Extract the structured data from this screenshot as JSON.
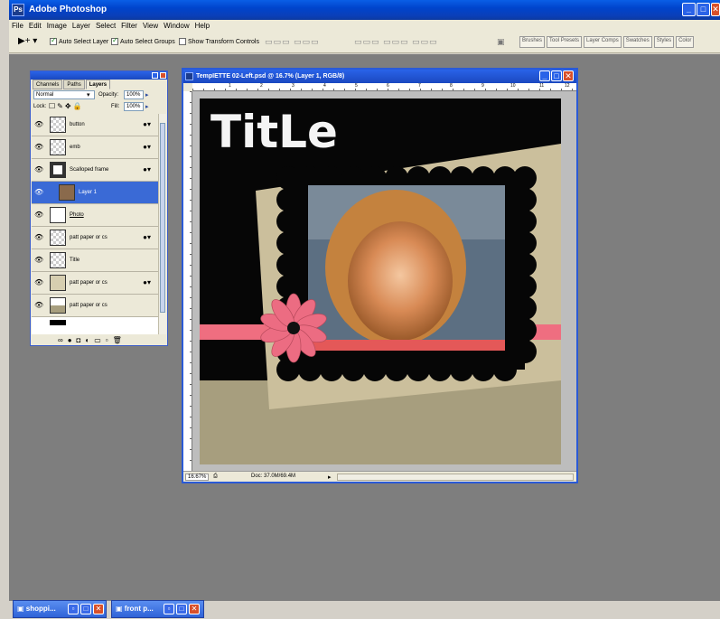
{
  "app": {
    "title": "Adobe Photoshop",
    "icon": "photoshop-icon",
    "logo_letters": "Ps"
  },
  "window_controls": {
    "minimize": "_",
    "maximize": "□",
    "close": "✕"
  },
  "menu": [
    "File",
    "Edit",
    "Image",
    "Layer",
    "Select",
    "Filter",
    "View",
    "Window",
    "Help"
  ],
  "options_bar": {
    "tool_glyph": "▶+ ▾",
    "auto_select_layer": {
      "label": "Auto Select Layer",
      "checked": true
    },
    "auto_select_groups": {
      "label": "Auto Select Groups",
      "checked": true
    },
    "show_transform_controls": {
      "label": "Show Transform Controls",
      "checked": false
    },
    "align_group_1": "▭▭▭ ▭▭▭",
    "align_group_2": "▭▭▭ ▭▭▭ ▭▭▭"
  },
  "palette_well": {
    "tabs": [
      "Brushes",
      "Tool Presets",
      "Layer Comps",
      "Swatches",
      "Styles",
      "Color"
    ]
  },
  "layers_palette": {
    "tabs": [
      "Channels",
      "Paths",
      "Layers"
    ],
    "active_tab": "Layers",
    "blend_mode": "Normal",
    "opacity_label": "Opacity:",
    "opacity_value": "100%",
    "lock_label": "Lock:",
    "fill_label": "Fill:",
    "fill_value": "100%",
    "layers": [
      {
        "name": "button",
        "fx": true,
        "selected": false
      },
      {
        "name": "emb",
        "fx": true,
        "selected": false
      },
      {
        "name": "Scalloped frame",
        "fx": true,
        "selected": false
      },
      {
        "name": "Layer 1",
        "fx": false,
        "selected": true
      },
      {
        "name": "Photo",
        "fx": false,
        "selected": false
      },
      {
        "name": "patt paper or cs",
        "fx": true,
        "selected": false
      },
      {
        "name": "Title",
        "fx": false,
        "selected": false
      },
      {
        "name": "patt paper or cs",
        "fx": true,
        "selected": false
      },
      {
        "name": "patt paper or cs",
        "fx": false,
        "selected": false
      }
    ]
  },
  "document": {
    "title": "TempIETTE 02-Left.psd @ 16.7% (Layer 1, RGB/8)",
    "zoom": "16.67%",
    "doc_size": "Doc: 37.0M/69.4M",
    "canvas_title_text": "TitLe",
    "ruler_numbers": [
      "1",
      "2",
      "3",
      "4",
      "5",
      "6",
      "7",
      "8",
      "9",
      "10",
      "11",
      "12"
    ],
    "colors": {
      "black": "#060606",
      "tan_paper": "#cbbf9c",
      "khaki_bottom": "#a79e7e",
      "ribbon_pink": "#ef6e80",
      "flower_pink": "#ec6c82"
    }
  },
  "taskbar": [
    {
      "label": "shoppi...",
      "icon": "photoshop-doc-icon"
    },
    {
      "label": "front p...",
      "icon": "photoshop-doc-icon"
    }
  ]
}
